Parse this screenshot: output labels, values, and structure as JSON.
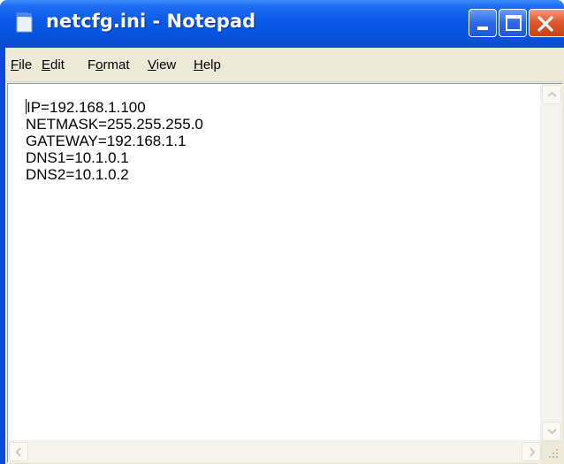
{
  "window": {
    "title": "netcfg.ini - Notepad",
    "app_icon": "notepad-icon"
  },
  "caption_buttons": {
    "minimize": "minimize-icon",
    "maximize": "maximize-icon",
    "close": "close-icon"
  },
  "menu": {
    "items": [
      {
        "mnemonic": "F",
        "rest": "ile"
      },
      {
        "mnemonic": "E",
        "rest": "dit"
      },
      {
        "pre": "F",
        "mnemonic": "o",
        "rest": "rmat"
      },
      {
        "mnemonic": "V",
        "rest": "iew"
      },
      {
        "mnemonic": "H",
        "rest": "elp"
      }
    ]
  },
  "editor": {
    "lines": [
      "IP=192.168.1.100",
      "NETMASK=255.255.255.0",
      "GATEWAY=192.168.1.1",
      "DNS1=10.1.0.1",
      "DNS2=10.1.0.2"
    ]
  },
  "scrollbars": {
    "up": "arrow-up-icon",
    "down": "arrow-down-icon",
    "left": "arrow-left-icon",
    "right": "arrow-right-icon",
    "grip": "resize-grip-icon"
  },
  "colors": {
    "titlebar": "#0a5ae8",
    "close_button": "#e05a2e",
    "menubar": "#ece9d8",
    "editor_bg": "#ffffff"
  }
}
